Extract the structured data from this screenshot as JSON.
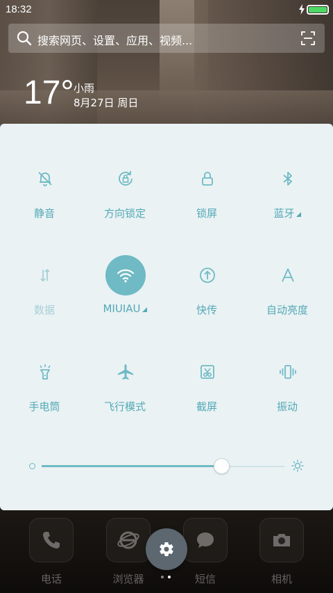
{
  "status_bar": {
    "time": "18:32",
    "battery_color": "#4cd964"
  },
  "search": {
    "placeholder": "搜索网页、设置、应用、视频..."
  },
  "weather": {
    "temperature": "17°",
    "condition": "小雨",
    "date": "8月27日 周日"
  },
  "accent_color": "#6fbac4",
  "toggles": [
    {
      "label": "静音",
      "icon": "bell-off-icon",
      "active": false,
      "enabled": true
    },
    {
      "label": "方向锁定",
      "icon": "rotation-lock-icon",
      "active": false,
      "enabled": true
    },
    {
      "label": "锁屏",
      "icon": "lock-icon",
      "active": false,
      "enabled": true
    },
    {
      "label": "蓝牙",
      "icon": "bluetooth-icon",
      "active": false,
      "enabled": true,
      "has_submenu": true
    },
    {
      "label": "数据",
      "icon": "data-arrows-icon",
      "active": false,
      "enabled": false
    },
    {
      "label": "MIUIAU",
      "icon": "wifi-icon",
      "active": true,
      "enabled": true,
      "has_submenu": true
    },
    {
      "label": "快传",
      "icon": "transfer-icon",
      "active": false,
      "enabled": true
    },
    {
      "label": "自动亮度",
      "icon": "auto-brightness-icon",
      "active": false,
      "enabled": true
    },
    {
      "label": "手电筒",
      "icon": "flashlight-icon",
      "active": false,
      "enabled": true
    },
    {
      "label": "飞行模式",
      "icon": "airplane-icon",
      "active": false,
      "enabled": true
    },
    {
      "label": "截屏",
      "icon": "screenshot-icon",
      "active": false,
      "enabled": true
    },
    {
      "label": "振动",
      "icon": "vibrate-icon",
      "active": false,
      "enabled": true
    }
  ],
  "brightness": {
    "level": 0.74
  },
  "dock": [
    {
      "label": "电话",
      "icon": "phone-icon"
    },
    {
      "label": "浏览器",
      "icon": "browser-icon"
    },
    {
      "label": "短信",
      "icon": "message-icon"
    },
    {
      "label": "相机",
      "icon": "camera-icon"
    }
  ],
  "page_indicator": {
    "count": 2,
    "current": 2
  }
}
